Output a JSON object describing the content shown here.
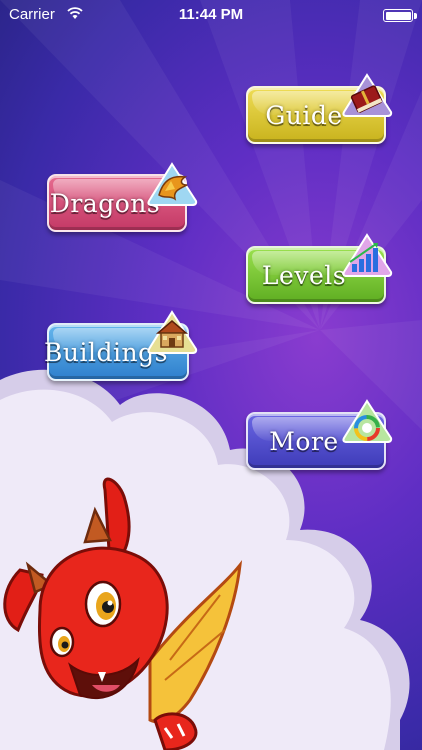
{
  "status_bar": {
    "carrier": "Carrier",
    "time": "11:44 PM"
  },
  "menu": {
    "guide": {
      "label": "Guide",
      "icon": "book-icon"
    },
    "dragons": {
      "label": "Dragons",
      "icon": "dragon-icon"
    },
    "levels": {
      "label": "Levels",
      "icon": "bar-chart-icon"
    },
    "buildings": {
      "label": "Buildings",
      "icon": "house-icon"
    },
    "more": {
      "label": "More",
      "icon": "swirl-icon"
    }
  },
  "colors": {
    "background": "#5f2ec4",
    "guide": "#e0cc3a",
    "dragons": "#d8507a",
    "levels": "#7cc83a",
    "buildings": "#4a9ae0",
    "more": "#5452d0",
    "dragon": "#e82a1e"
  }
}
